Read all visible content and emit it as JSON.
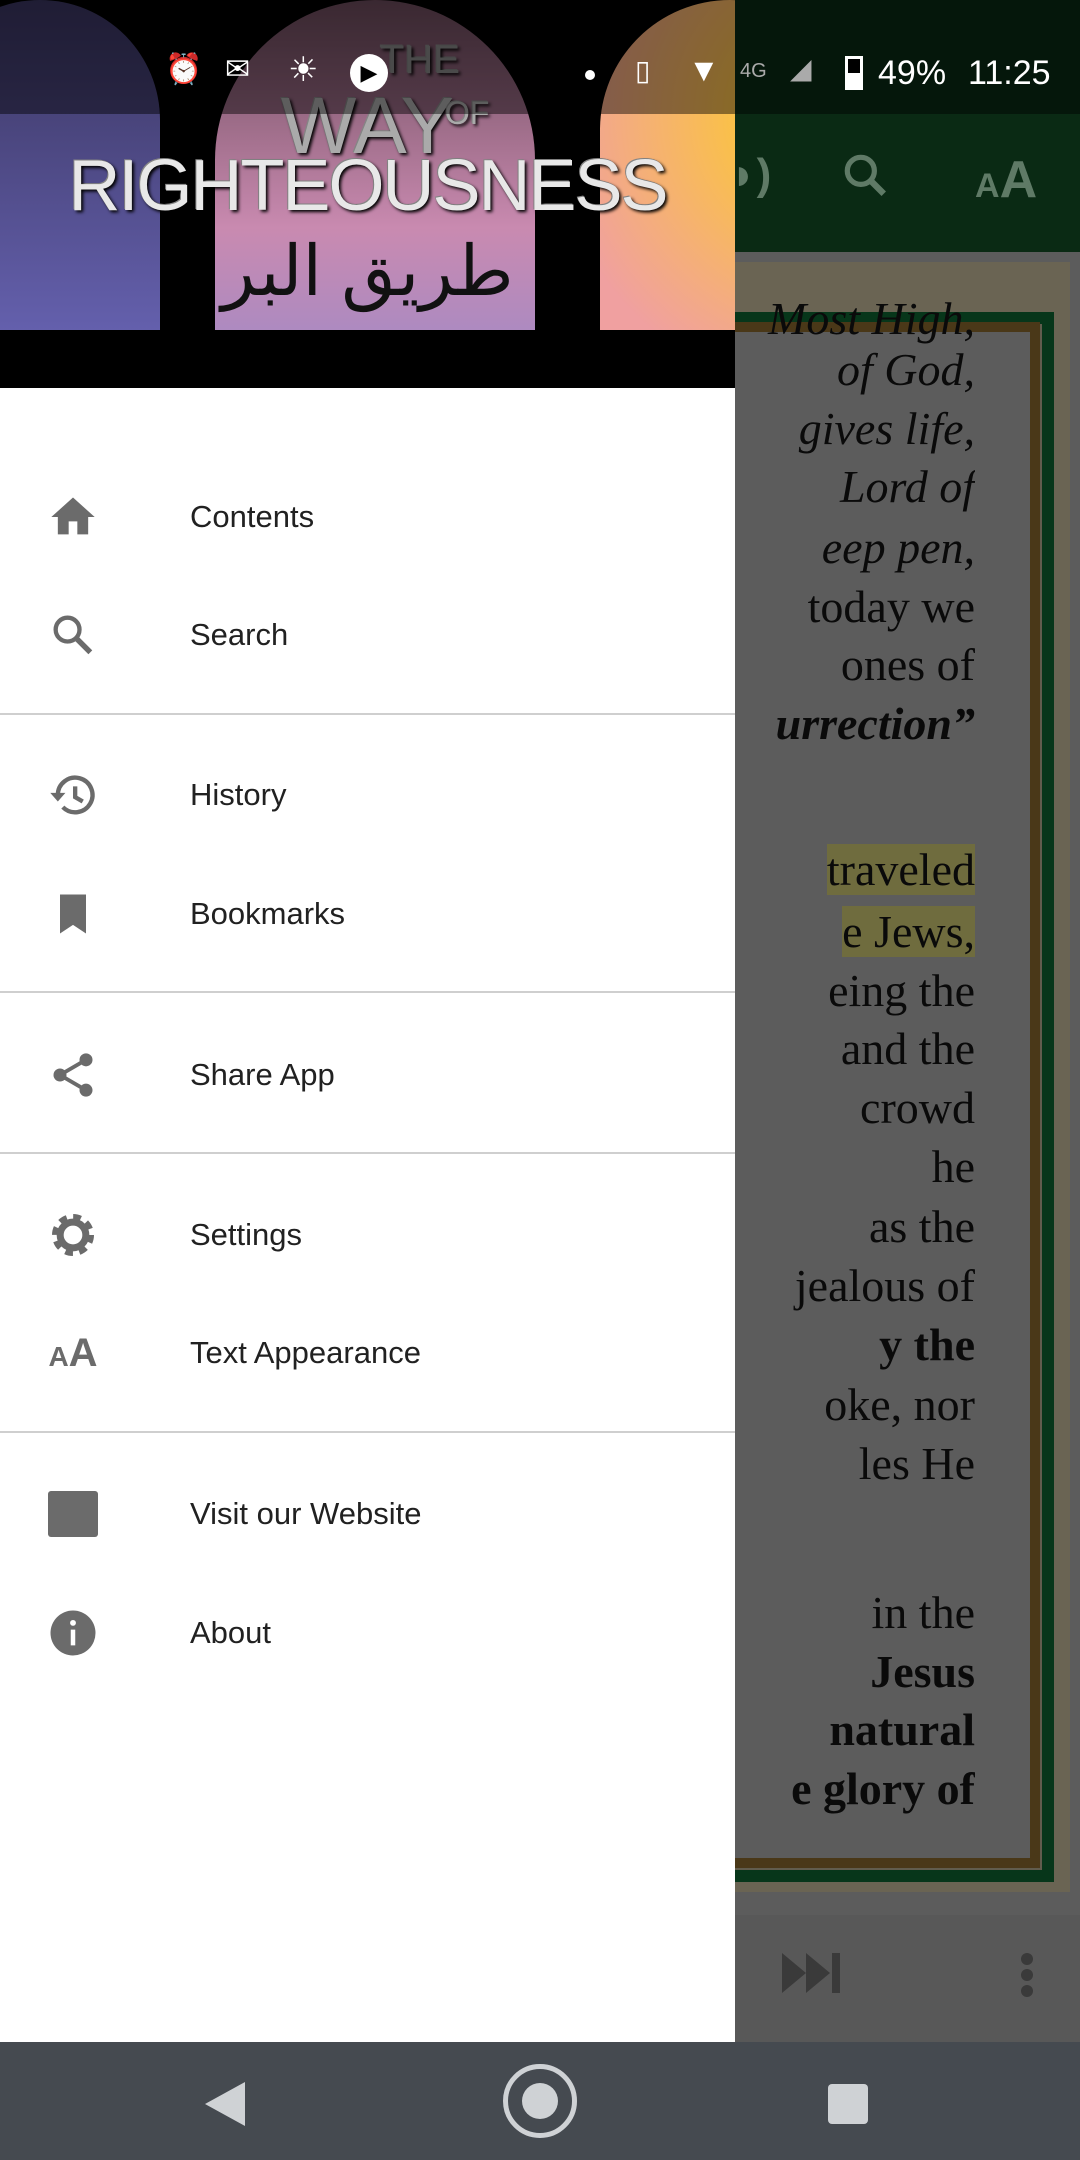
{
  "status_bar": {
    "battery": "49%",
    "time": "11:25",
    "icons": [
      "alarm-icon",
      "gmail-icon",
      "brightness-icon",
      "play-icon",
      "dot-icon",
      "vibrate-icon",
      "wifi-icon",
      "4g-icon",
      "signal-icon",
      "battery-icon"
    ]
  },
  "app_toolbar": {
    "icons": [
      "audio-icon",
      "search-icon",
      "text-size-icon"
    ],
    "text_size_glyph": "AA"
  },
  "header": {
    "logo_line1": "THE",
    "logo_line2": "WAY",
    "logo_of": "OF",
    "logo_line3": "RIGHTEOUSNESS",
    "logo_arabic": "طريق البر"
  },
  "drawer": {
    "items": [
      {
        "label": "Contents",
        "icon": "home-icon"
      },
      {
        "label": "Search",
        "icon": "search-icon"
      },
      {
        "label": "History",
        "icon": "history-icon"
      },
      {
        "label": "Bookmarks",
        "icon": "bookmark-icon"
      },
      {
        "label": "Share App",
        "icon": "share-icon"
      },
      {
        "label": "Settings",
        "icon": "gear-icon"
      },
      {
        "label": "Text Appearance",
        "icon": "text-size-icon"
      },
      {
        "label": "Visit our Website",
        "icon": "website-icon"
      },
      {
        "label": "About",
        "icon": "info-icon"
      }
    ]
  },
  "reader": {
    "lines": [
      {
        "t": "Most High,",
        "s": "it"
      },
      {
        "t": "of God,",
        "s": "it"
      },
      {
        "t": "gives life,",
        "s": "it"
      },
      {
        "t": "Lord of",
        "s": "it"
      },
      {
        "t": "eep pen,",
        "s": "it"
      },
      {
        "t": "today we",
        "s": ""
      },
      {
        "t": "ones of",
        "s": ""
      },
      {
        "t": "urrection”",
        "s": "it bd"
      },
      {
        "t": "traveled",
        "s": "hl"
      },
      {
        "t": "e Jews,",
        "s": "hl"
      },
      {
        "t": "eing the",
        "s": ""
      },
      {
        "t": "and the",
        "s": ""
      },
      {
        "t": "crowd",
        "s": ""
      },
      {
        "t": "he",
        "s": ""
      },
      {
        "t": "as the",
        "s": ""
      },
      {
        "t": "jealous of",
        "s": ""
      },
      {
        "t": "y the",
        "s": "bd"
      },
      {
        "t": "oke, nor",
        "s": ""
      },
      {
        "t": "les He",
        "s": "mix"
      },
      {
        "t": "in the",
        "s": ""
      },
      {
        "t": "Jesus",
        "s": "bd"
      },
      {
        "t": "natural",
        "s": "bd"
      },
      {
        "t": "e glory of",
        "s": "bd"
      }
    ]
  },
  "bottom_bar": {
    "icons": [
      "skip-next-icon",
      "more-vert-icon"
    ]
  },
  "nav_bar": {
    "icons": [
      "back-icon",
      "home-icon",
      "recents-icon"
    ]
  }
}
